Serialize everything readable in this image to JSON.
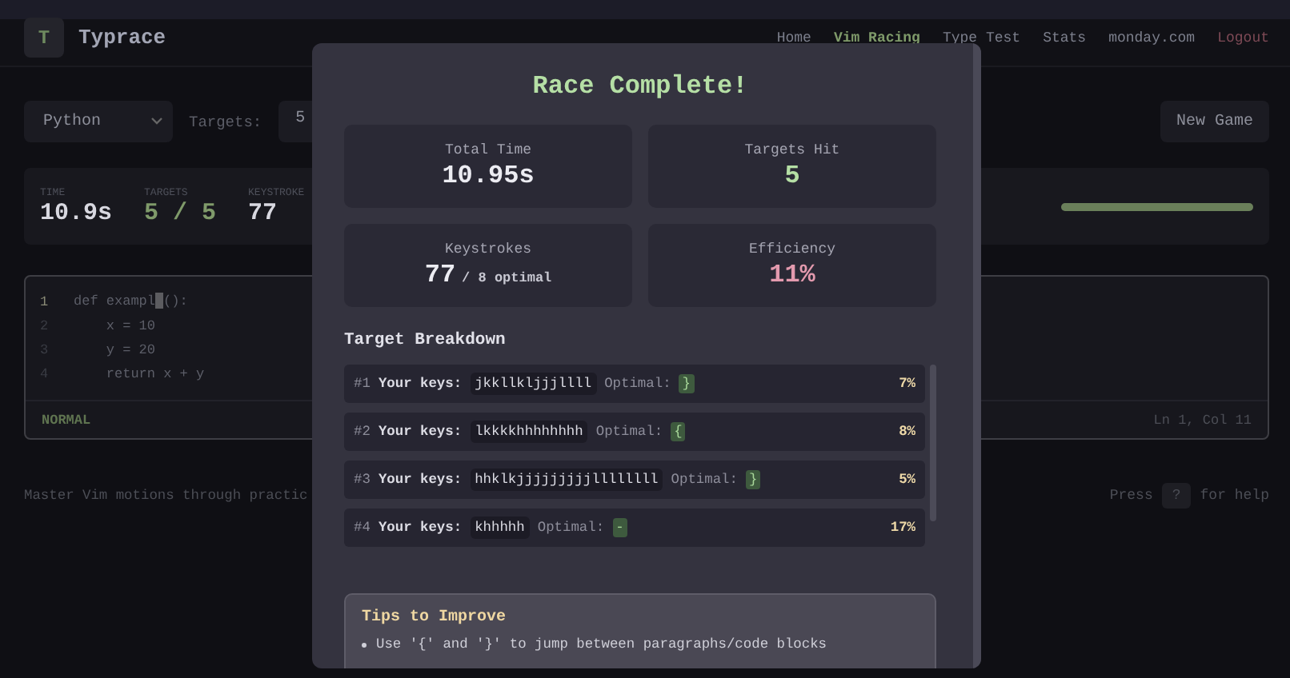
{
  "app": {
    "logo_letter": "T",
    "name": "Typrace"
  },
  "nav": [
    {
      "label": "Home",
      "selected": false,
      "kind": "link"
    },
    {
      "label": "Vim Racing",
      "selected": true,
      "kind": "link"
    },
    {
      "label": "Type Test",
      "selected": false,
      "kind": "link"
    },
    {
      "label": "Stats",
      "selected": false,
      "kind": "link"
    },
    {
      "label": "monday.com",
      "selected": false,
      "kind": "link"
    },
    {
      "label": "Logout",
      "selected": false,
      "kind": "logout"
    }
  ],
  "controls": {
    "language": "Python",
    "targets_label": "Targets:",
    "targets_value": "5",
    "new_game": "New Game"
  },
  "stats": [
    {
      "label": "TIME",
      "value": "10.9s",
      "kind": "plain"
    },
    {
      "label": "TARGETS",
      "value": "5 / 5",
      "kind": "accent"
    },
    {
      "label": "KEYSTROKE",
      "value": "77",
      "kind": "plain"
    }
  ],
  "progress": {
    "level": 1
  },
  "editor": {
    "lines": [
      {
        "number": "1",
        "text": "def exampl",
        "cursor": true,
        "rest": "():",
        "current": true
      },
      {
        "number": "2",
        "text": "    x = 10",
        "cursor": false,
        "current": false
      },
      {
        "number": "3",
        "text": "    y = 20",
        "cursor": false,
        "current": false
      },
      {
        "number": "4",
        "text": "    return x + y",
        "cursor": false,
        "current": false
      }
    ],
    "mode": "NORMAL",
    "position": "Ln 1, Col 11"
  },
  "footer": {
    "tagline": "Master Vim motions through practic",
    "help_prefix": "Press",
    "help_key": "?",
    "help_suffix": "for help"
  },
  "modal": {
    "title": "Race Complete!",
    "stats": [
      {
        "label": "Total Time",
        "value": "10.95s",
        "kind": "plain"
      },
      {
        "label": "Targets Hit",
        "value": "5",
        "kind": "good"
      },
      {
        "label": "Keystrokes",
        "value": "77",
        "suffix": "/ 8 optimal",
        "kind": "plain"
      },
      {
        "label": "Efficiency",
        "value": "11%",
        "kind": "bad"
      }
    ],
    "breakdown_title": "Target Breakdown",
    "targets": [
      {
        "index": "#1",
        "keys_label": "Your keys:",
        "keys": "jkkllkljjjllll",
        "optimal_label": "Optimal:",
        "optimal": "}",
        "percent": "7%"
      },
      {
        "index": "#2",
        "keys_label": "Your keys:",
        "keys": "lkkkkhhhhhhhh",
        "optimal_label": "Optimal:",
        "optimal": "{",
        "percent": "8%"
      },
      {
        "index": "#3",
        "keys_label": "Your keys:",
        "keys": "hhklkjjjjjjjjjllllllll",
        "optimal_label": "Optimal:",
        "optimal": "}",
        "percent": "5%"
      },
      {
        "index": "#4",
        "keys_label": "Your keys:",
        "keys": "khhhhh",
        "optimal_label": "Optimal:",
        "optimal": "-",
        "percent": "17%"
      }
    ],
    "tips": {
      "title": "Tips to Improve",
      "items": [
        "Use '{' and '}' to jump between paragraphs/code blocks"
      ]
    }
  }
}
